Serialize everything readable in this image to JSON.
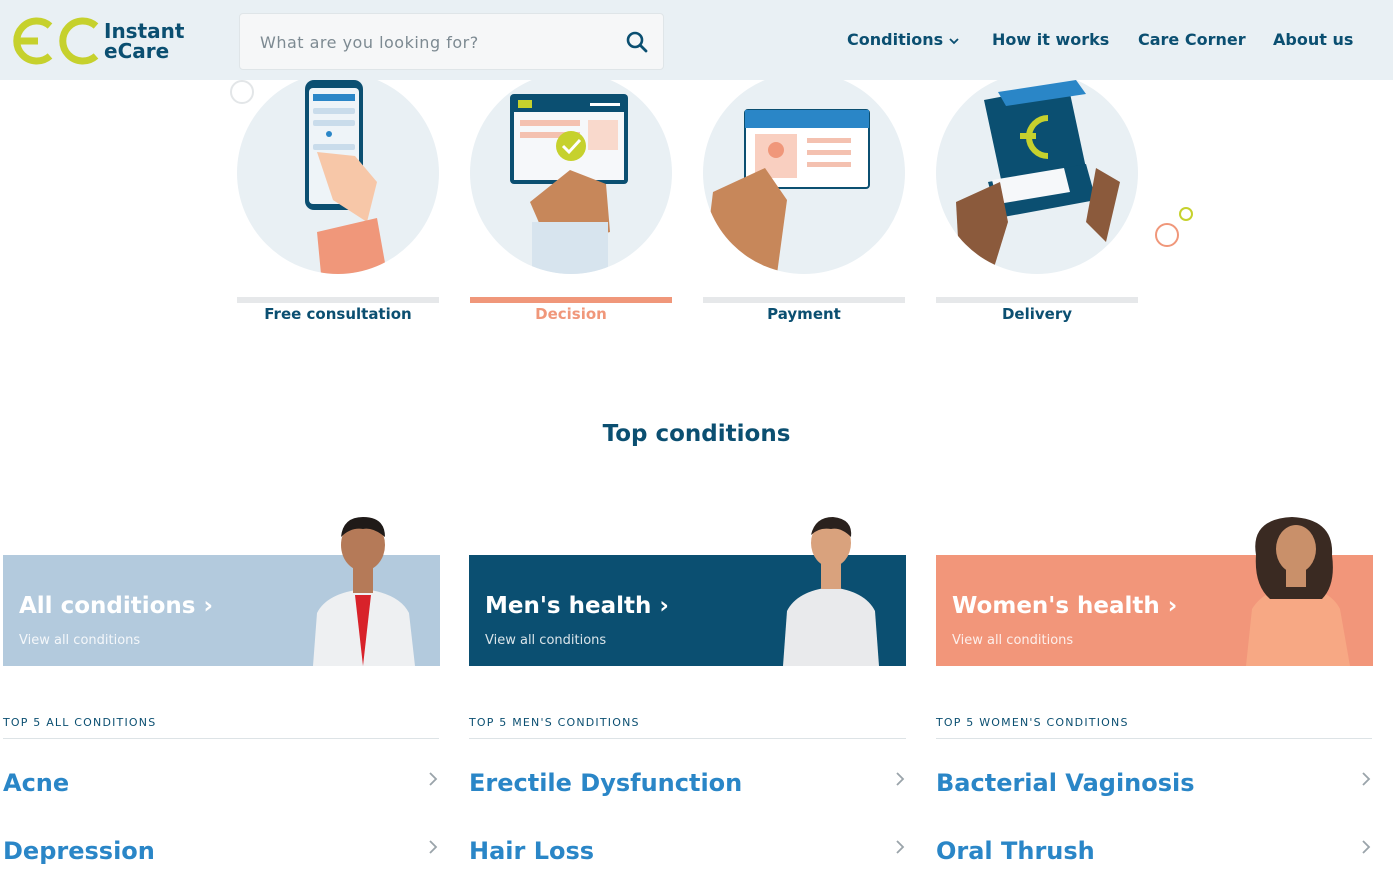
{
  "header": {
    "logo_line1": "Instant",
    "logo_line2": "eCare",
    "search_placeholder": "What are you looking for?",
    "nav": [
      {
        "label": "Conditions"
      },
      {
        "label": "How it works"
      },
      {
        "label": "Care Corner"
      },
      {
        "label": "About us"
      }
    ]
  },
  "steps": [
    {
      "label": "Free consultation",
      "active": false
    },
    {
      "label": "Decision",
      "active": true
    },
    {
      "label": "Payment",
      "active": false
    },
    {
      "label": "Delivery",
      "active": false
    }
  ],
  "top_conditions": {
    "title": "Top conditions",
    "cards": [
      {
        "title": "All conditions",
        "subtitle": "View all conditions",
        "color": "#b3cadd"
      },
      {
        "title": "Men's health",
        "subtitle": "View all conditions",
        "color": "#0b4f71"
      },
      {
        "title": "Women's health",
        "subtitle": "View all conditions",
        "color": "#f2967a"
      }
    ],
    "lists": [
      {
        "heading": "TOP 5 ALL CONDITIONS",
        "items": [
          "Acne",
          "Depression"
        ]
      },
      {
        "heading": "TOP 5 MEN'S CONDITIONS",
        "items": [
          "Erectile Dysfunction",
          "Hair Loss"
        ]
      },
      {
        "heading": "TOP 5 WOMEN'S CONDITIONS",
        "items": [
          "Bacterial Vaginosis",
          "Oral Thrush"
        ]
      }
    ]
  },
  "colors": {
    "brand_navy": "#0b4f71",
    "brand_lime": "#c6d12d",
    "accent_salmon": "#f0977a",
    "link_blue": "#2a86c7"
  }
}
